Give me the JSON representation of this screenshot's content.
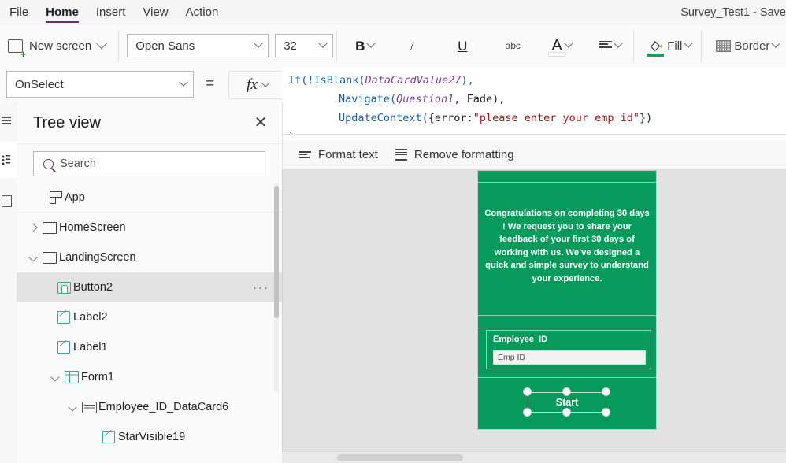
{
  "menu": {
    "items": [
      {
        "label": "File",
        "active": false
      },
      {
        "label": "Home",
        "active": true
      },
      {
        "label": "Insert",
        "active": false
      },
      {
        "label": "View",
        "active": false
      },
      {
        "label": "Action",
        "active": false
      }
    ],
    "document_title": "Survey_Test1 - Save"
  },
  "ribbon": {
    "new_screen_label": "New screen",
    "font_family_value": "Open Sans",
    "font_size_value": "32",
    "bold_label": "B",
    "italic_label": "/",
    "underline_label": "U",
    "strikethrough_label": "abc",
    "font_color_label": "A",
    "font_color_swatch": "#ffffff",
    "align_label": "align",
    "fill_label": "Fill",
    "fill_swatch": "#12a05e",
    "border_label": "Border"
  },
  "property_bar": {
    "property_value": "OnSelect",
    "equals": "=",
    "fx_label": "fx"
  },
  "formula": {
    "line1_fn": "If(",
    "line1_bang": "!IsBlank(",
    "line1_ident": "DataCardValue27",
    "line1_close": "),",
    "line2_fn": "Navigate(",
    "line2_ident": "Question1",
    "line2_rest": ", Fade),",
    "line3_fn": "UpdateContext(",
    "line3_brace": "{error:",
    "line3_str": "\"please enter your emp id\"",
    "line3_close": "})",
    "line4": ")"
  },
  "format_bar": {
    "format_text_label": "Format text",
    "remove_formatting_label": "Remove formatting"
  },
  "tree_view": {
    "title": "Tree view",
    "close_label": "✕",
    "search_placeholder": "Search",
    "items": [
      {
        "label": "App",
        "icon": "app-icon",
        "indent": 0,
        "twisty": "none",
        "selected": false
      },
      {
        "label": "HomeScreen",
        "icon": "screen-icon",
        "indent": 0,
        "twisty": "right",
        "selected": false
      },
      {
        "label": "LandingScreen",
        "icon": "screen-icon",
        "indent": 0,
        "twisty": "down",
        "selected": false
      },
      {
        "label": "Button2",
        "icon": "button-icon",
        "indent": 1,
        "twisty": "none",
        "selected": true,
        "overflow": "···"
      },
      {
        "label": "Label2",
        "icon": "label-icon",
        "indent": 1,
        "twisty": "none",
        "selected": false
      },
      {
        "label": "Label1",
        "icon": "label-icon",
        "indent": 1,
        "twisty": "none",
        "selected": false
      },
      {
        "label": "Form1",
        "icon": "form-icon",
        "indent": 1,
        "twisty": "down",
        "selected": false
      },
      {
        "label": "Employee_ID_DataCard6",
        "icon": "datacard-icon",
        "indent": 2,
        "twisty": "down",
        "selected": false
      },
      {
        "label": "StarVisible19",
        "icon": "label-icon",
        "indent": 3,
        "twisty": "none",
        "selected": false
      }
    ]
  },
  "canvas": {
    "screen_background": "#069a5c",
    "message": "Congratulations on completing 30 days ! We request you to share your feedback of your first 30 days of working with us. We’ve designed a quick and simple survey to understand your experience.",
    "datacard_label": "Employee_ID",
    "input_placeholder": "Emp ID",
    "button_label": "Start"
  }
}
